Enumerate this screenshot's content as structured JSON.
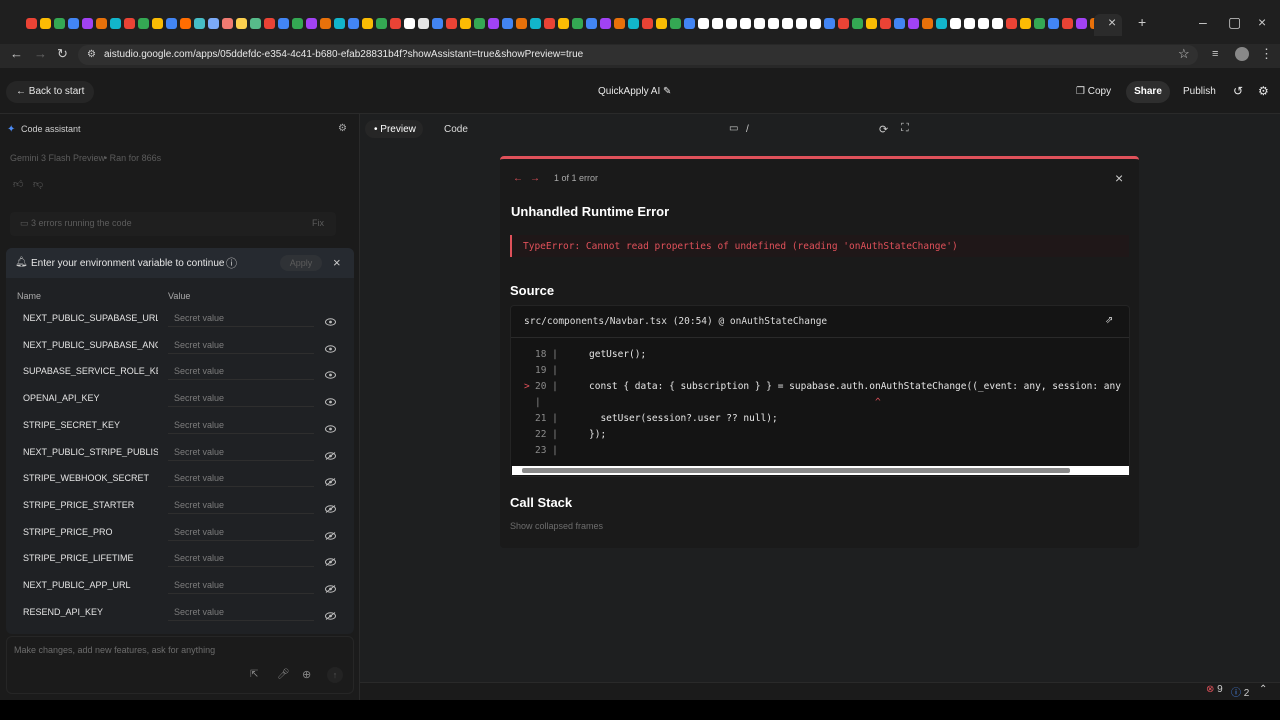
{
  "browser": {
    "url": "aistudio.google.com/apps/05ddefdc-e354-4c41-b680-efab28831b4f?showAssistant=true&showPreview=true",
    "tab_colors": [
      "#ea4335",
      "#fbbc04",
      "#34a853",
      "#4285f4",
      "#a142f4",
      "#e8710a",
      "#12b5cb",
      "#ea4335",
      "#34a853",
      "#fbbc04",
      "#4285f4",
      "#ff6d01",
      "#46bdc6",
      "#7baaf7",
      "#f07b72",
      "#fcd04f",
      "#57bb8a",
      "#ea4335",
      "#4285f4",
      "#34a853",
      "#a142f4",
      "#e8710a",
      "#12b5cb",
      "#4285f4",
      "#fbbc04",
      "#34a853",
      "#ea4335",
      "#fff",
      "#e6e6e6",
      "#4285f4",
      "#ea4335",
      "#fbbc04",
      "#34a853",
      "#a142f4",
      "#4285f4",
      "#e8710a",
      "#12b5cb",
      "#ea4335",
      "#fbbc04",
      "#34a853",
      "#4285f4",
      "#a142f4",
      "#e8710a",
      "#12b5cb",
      "#ea4335",
      "#fbbc04",
      "#34a853",
      "#4285f4",
      "#ffffff",
      "#ffffff",
      "#ffffff",
      "#ffffff",
      "#ffffff",
      "#ffffff",
      "#ffffff",
      "#ffffff",
      "#ffffff",
      "#4285f4",
      "#ea4335",
      "#34a853",
      "#fbbc04",
      "#ea4335",
      "#4285f4",
      "#a142f4",
      "#e8710a",
      "#12b5cb",
      "#ffffff",
      "#ffffff",
      "#ffffff",
      "#ffffff",
      "#ea4335",
      "#fbbc04",
      "#34a853",
      "#4285f4",
      "#ea4335",
      "#a142f4",
      "#e8710a",
      "#12b5cb",
      "#ea4335"
    ]
  },
  "header": {
    "back_label": "Back to start",
    "app_title": "QuickApply AI",
    "copy_label": "Copy",
    "share_label": "Share",
    "publish_label": "Publish"
  },
  "assistant": {
    "title": "Code assistant",
    "model_line": "Gemini 3 Flash Preview",
    "ran_for": "Ran for 866s",
    "errors_text": "3 errors running the code",
    "fix_label": "Fix",
    "prompt_placeholder": "Make changes, add new features, ask for anything"
  },
  "env": {
    "prompt": "Enter your environment variable to continue",
    "apply_label": "Apply",
    "col_name": "Name",
    "col_value": "Value",
    "placeholder": "Secret value",
    "rows": [
      "NEXT_PUBLIC_SUPABASE_URL",
      "NEXT_PUBLIC_SUPABASE_ANON_KEY",
      "SUPABASE_SERVICE_ROLE_KEY",
      "OPENAI_API_KEY",
      "STRIPE_SECRET_KEY",
      "NEXT_PUBLIC_STRIPE_PUBLISHABLE_KEY",
      "STRIPE_WEBHOOK_SECRET",
      "STRIPE_PRICE_STARTER",
      "STRIPE_PRICE_PRO",
      "STRIPE_PRICE_LIFETIME",
      "NEXT_PUBLIC_APP_URL",
      "RESEND_API_KEY"
    ]
  },
  "preview": {
    "tab_preview": "Preview",
    "tab_code": "Code",
    "path": "/"
  },
  "error": {
    "counter": "1 of 1 error",
    "title": "Unhandled Runtime Error",
    "message": "TypeError: Cannot read properties of undefined (reading 'onAuthStateChange')",
    "source_heading": "Source",
    "source_file": "src/components/Navbar.tsx (20:54) @ onAuthStateChange",
    "code_lines": [
      {
        "num": "18",
        "text": "getUser();",
        "marker": ""
      },
      {
        "num": "19",
        "text": "",
        "marker": ""
      },
      {
        "num": "20",
        "text": "const { data: { subscription } } = supabase.auth.onAuthStateChange((_event: any, session: any",
        "marker": ">"
      },
      {
        "num": "",
        "text": "^",
        "marker": ""
      },
      {
        "num": "21",
        "text": "  setUser(session?.user ?? null);",
        "marker": ""
      },
      {
        "num": "22",
        "text": "});",
        "marker": ""
      },
      {
        "num": "23",
        "text": "",
        "marker": ""
      }
    ],
    "callstack_heading": "Call Stack",
    "collapsed_frames": "Show collapsed frames"
  },
  "status": {
    "errors": "9",
    "infos": "2"
  },
  "colors": {
    "error_red": "#e0515a",
    "accent_blue": "#4d8df7"
  }
}
